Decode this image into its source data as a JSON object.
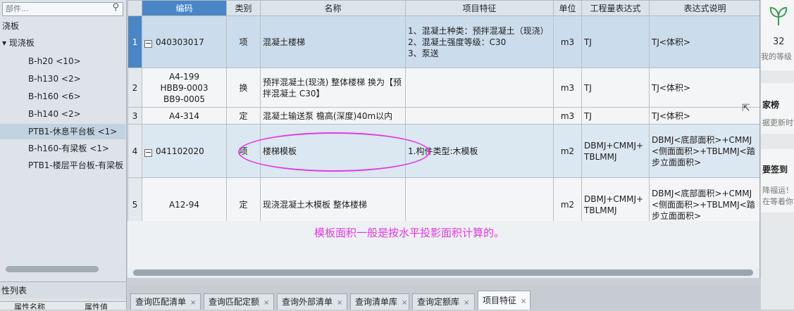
{
  "left_panel": {
    "search_placeholder": "部件...",
    "tree": [
      {
        "label": "浇板"
      },
      {
        "label": "▾ 现浇板"
      },
      {
        "label": "B-h20 <10>"
      },
      {
        "label": "B-h130 <2>"
      },
      {
        "label": "B-h160 <6>"
      },
      {
        "label": "B-h140 <2>"
      },
      {
        "label": "PTB1-休息平台板 <1>",
        "selected": true
      },
      {
        "label": "B-h160-有梁板 <1>"
      },
      {
        "label": "PTB1-楼层平台板-有梁板"
      }
    ],
    "properties_title": "性列表",
    "prop_col_name": "属性名称",
    "prop_col_value": "属性值"
  },
  "grid": {
    "columns": [
      "",
      "编码",
      "类别",
      "名称",
      "项目特征",
      "单位",
      "工程量表达式",
      "表达式说明"
    ],
    "rows": [
      {
        "num": "1",
        "toggle": "−",
        "code": [
          "040303017"
        ],
        "category": "项",
        "name": "混凝土楼梯",
        "features": [
          "1、混凝土种类：预拌混凝土（现浇）",
          "2、混凝土强度等级：C30",
          "3、泵送"
        ],
        "unit": "m3",
        "expr": "TJ",
        "desc": "TJ<体积>"
      },
      {
        "num": "2",
        "toggle": "",
        "code": [
          "A4-199",
          "HBB9-0003",
          "BB9-0005"
        ],
        "category": "换",
        "name": "预拌混凝土(现浇) 整体楼梯 换为【预拌混凝土 C30】",
        "features": [],
        "unit": "m3",
        "expr": "TJ",
        "desc": "TJ<体积>"
      },
      {
        "num": "3",
        "toggle": "",
        "code": [
          "A4-314"
        ],
        "category": "定",
        "name": "混凝土输送泵 檐高(深度)40m以内",
        "features": [],
        "unit": "m3",
        "expr": "TJ",
        "desc": "TJ<体积>"
      },
      {
        "num": "4",
        "toggle": "−",
        "code": [
          "041102020"
        ],
        "category": "项",
        "name": "楼梯模板",
        "features": [
          "1.构件类型:木模板"
        ],
        "unit": "m2",
        "expr": "DBMJ+CMMJ+TBLMMJ",
        "desc": "DBMJ<底部面积>+CMMJ<侧面面积>+TBLMMJ<踏步立面面积>"
      },
      {
        "num": "5",
        "toggle": "",
        "code": [
          "A12-94"
        ],
        "category": "定",
        "name": "现浇混凝土木模板 整体楼梯",
        "features": [],
        "unit": "m2",
        "expr": "DBMJ+CMMJ+TBLMMJ",
        "desc": "DBMJ<底部面积>+CMMJ<侧面面积>+TBLMMJ<踏步立面面积>"
      }
    ]
  },
  "annotation": {
    "text": "模板面积一般是按水平投影面积计算的。",
    "color": "#e23ae4"
  },
  "tabs": [
    {
      "label": "查询匹配清单",
      "close": "×"
    },
    {
      "label": "查询匹配定额",
      "close": "×"
    },
    {
      "label": "查询外部清单",
      "close": "×"
    },
    {
      "label": "查询清单库",
      "close": "×"
    },
    {
      "label": "查询定额库",
      "close": "×"
    },
    {
      "label": "项目特征",
      "close": "×",
      "active": true
    }
  ],
  "right_panel": {
    "count": "32",
    "my_level": "我的等级",
    "rank_title": "家榜",
    "rank_sub": "据更新时",
    "signin_title": "要签到",
    "signin_sub1": "降福运！",
    "signin_sub2": "在等着你"
  },
  "colors": {
    "accent": "#4a86c5",
    "annotation": "#e23ae4",
    "leaf": "#3d9a55"
  }
}
